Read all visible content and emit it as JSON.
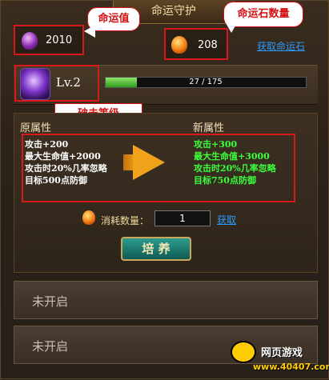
{
  "window": {
    "title": "命运守护"
  },
  "annotations": {
    "fate_value": "命运值",
    "fate_stone_count": "命运石数量",
    "break_level": "破击等级"
  },
  "resources": {
    "fate_value": "2010",
    "fate_stone": "208",
    "get_stone_link": "获取命运石"
  },
  "level": {
    "label": "Lv.2",
    "progress_text": "27 / 175",
    "progress_fraction": 0.154
  },
  "attributes": {
    "old_title": "原属性",
    "new_title": "新属性",
    "old": [
      "攻击+200",
      "最大生命值+2000",
      "攻击时20%几率忽略",
      "目标500点防御"
    ],
    "new": [
      "攻击+300",
      "最大生命值+3000",
      "攻击时20%几率忽略",
      "目标750点防御"
    ]
  },
  "cost": {
    "label": "消耗数量：",
    "quantity": "1",
    "get_link": "获取"
  },
  "cultivate_button": "培 养",
  "locked_slots": [
    "未开启",
    "未开启"
  ],
  "watermark": {
    "site_name": "网页游戏",
    "url": "www.40407.com"
  },
  "colors": {
    "callout_red": "#d40f12",
    "new_attr_green": "#3cff3c",
    "link_blue": "#2a9cff"
  }
}
